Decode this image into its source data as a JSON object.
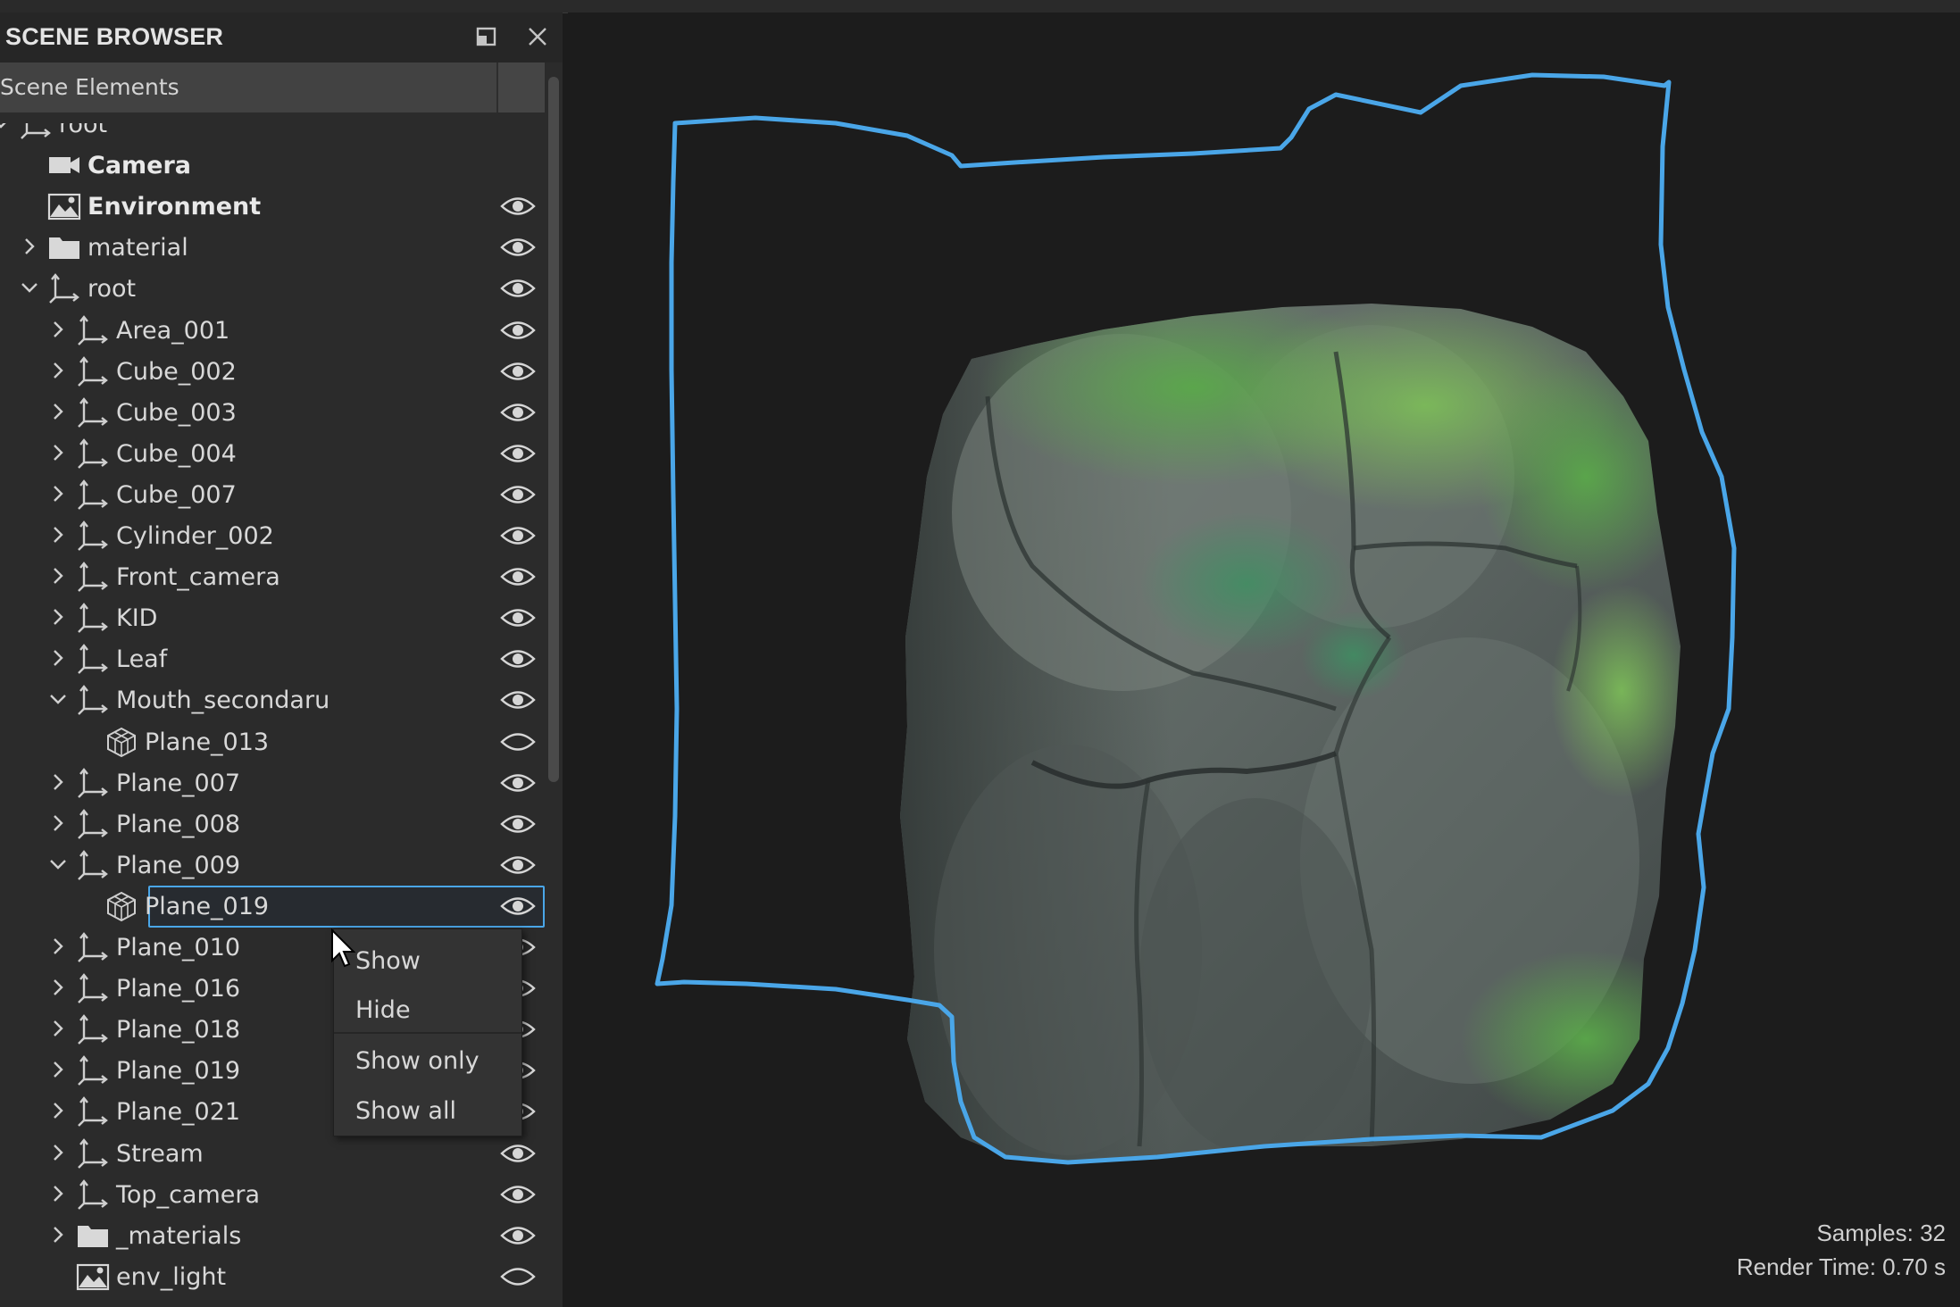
{
  "panel": {
    "title": "SCENE BROWSER",
    "column_header": "Scene Elements",
    "icons": {
      "undock": "undock-icon",
      "close": "close-icon"
    }
  },
  "tree": [
    {
      "label": "root",
      "depth": 0,
      "expander": "expanded",
      "icon": "axis-icon",
      "bold": false,
      "visibility": "none"
    },
    {
      "label": "Camera",
      "depth": 1,
      "expander": "none",
      "icon": "camera-icon",
      "bold": true,
      "visibility": "none"
    },
    {
      "label": "Environment",
      "depth": 1,
      "expander": "none",
      "icon": "environment-icon",
      "bold": true,
      "visibility": "visible"
    },
    {
      "label": "material",
      "depth": 1,
      "expander": "collapsed",
      "icon": "folder-icon",
      "bold": false,
      "visibility": "visible"
    },
    {
      "label": "root",
      "depth": 1,
      "expander": "expanded",
      "icon": "axis-icon",
      "bold": false,
      "visibility": "visible"
    },
    {
      "label": "Area_001",
      "depth": 2,
      "expander": "collapsed",
      "icon": "axis-icon",
      "bold": false,
      "visibility": "visible"
    },
    {
      "label": "Cube_002",
      "depth": 2,
      "expander": "collapsed",
      "icon": "axis-icon",
      "bold": false,
      "visibility": "visible"
    },
    {
      "label": "Cube_003",
      "depth": 2,
      "expander": "collapsed",
      "icon": "axis-icon",
      "bold": false,
      "visibility": "visible"
    },
    {
      "label": "Cube_004",
      "depth": 2,
      "expander": "collapsed",
      "icon": "axis-icon",
      "bold": false,
      "visibility": "visible"
    },
    {
      "label": "Cube_007",
      "depth": 2,
      "expander": "collapsed",
      "icon": "axis-icon",
      "bold": false,
      "visibility": "visible"
    },
    {
      "label": "Cylinder_002",
      "depth": 2,
      "expander": "collapsed",
      "icon": "axis-icon",
      "bold": false,
      "visibility": "visible"
    },
    {
      "label": "Front_camera",
      "depth": 2,
      "expander": "collapsed",
      "icon": "axis-icon",
      "bold": false,
      "visibility": "visible"
    },
    {
      "label": "KID",
      "depth": 2,
      "expander": "collapsed",
      "icon": "axis-icon",
      "bold": false,
      "visibility": "visible"
    },
    {
      "label": "Leaf",
      "depth": 2,
      "expander": "collapsed",
      "icon": "axis-icon",
      "bold": false,
      "visibility": "visible"
    },
    {
      "label": "Mouth_secondaru",
      "depth": 2,
      "expander": "expanded",
      "icon": "axis-icon",
      "bold": false,
      "visibility": "visible"
    },
    {
      "label": "Plane_013",
      "depth": 3,
      "expander": "none",
      "icon": "mesh-icon",
      "bold": false,
      "visibility": "hidden"
    },
    {
      "label": "Plane_007",
      "depth": 2,
      "expander": "collapsed",
      "icon": "axis-icon",
      "bold": false,
      "visibility": "visible"
    },
    {
      "label": "Plane_008",
      "depth": 2,
      "expander": "collapsed",
      "icon": "axis-icon",
      "bold": false,
      "visibility": "visible"
    },
    {
      "label": "Plane_009",
      "depth": 2,
      "expander": "expanded",
      "icon": "axis-icon",
      "bold": false,
      "visibility": "visible"
    },
    {
      "label": "Plane_019",
      "depth": 3,
      "expander": "none",
      "icon": "mesh-icon",
      "bold": false,
      "visibility": "visible",
      "selected": true
    },
    {
      "label": "Plane_010",
      "depth": 2,
      "expander": "collapsed",
      "icon": "axis-icon",
      "bold": false,
      "visibility": "visible"
    },
    {
      "label": "Plane_016",
      "depth": 2,
      "expander": "collapsed",
      "icon": "axis-icon",
      "bold": false,
      "visibility": "visible"
    },
    {
      "label": "Plane_018",
      "depth": 2,
      "expander": "collapsed",
      "icon": "axis-icon",
      "bold": false,
      "visibility": "visible"
    },
    {
      "label": "Plane_019",
      "depth": 2,
      "expander": "collapsed",
      "icon": "axis-icon",
      "bold": false,
      "visibility": "visible"
    },
    {
      "label": "Plane_021",
      "depth": 2,
      "expander": "collapsed",
      "icon": "axis-icon",
      "bold": false,
      "visibility": "visible"
    },
    {
      "label": "Stream",
      "depth": 2,
      "expander": "collapsed",
      "icon": "axis-icon",
      "bold": false,
      "visibility": "visible"
    },
    {
      "label": "Top_camera",
      "depth": 2,
      "expander": "collapsed",
      "icon": "axis-icon",
      "bold": false,
      "visibility": "visible"
    },
    {
      "label": "_materials",
      "depth": 2,
      "expander": "collapsed",
      "icon": "folder-icon",
      "bold": false,
      "visibility": "visible"
    },
    {
      "label": "env_light",
      "depth": 2,
      "expander": "none",
      "icon": "environment-icon",
      "bold": false,
      "visibility": "hidden"
    }
  ],
  "context_menu": {
    "items": [
      "Show",
      "Hide",
      "Show only",
      "Show all"
    ]
  },
  "viewport": {
    "samples": "Samples: 32",
    "render_time": "Render Time: 0.70 s"
  },
  "colors": {
    "selection_outline": "#4aa6e8",
    "panel_bg": "#2b2b2b",
    "viewport_bg": "#1c1c1c"
  }
}
